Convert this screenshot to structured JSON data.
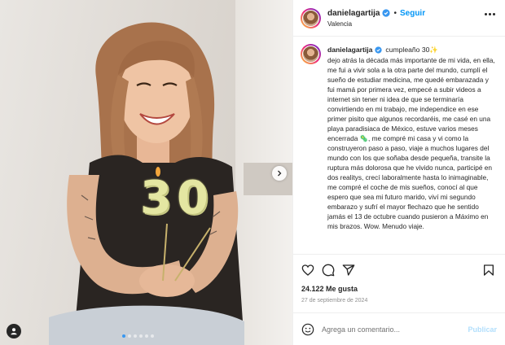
{
  "post": {
    "username": "danielagartija",
    "follow_label": "Seguir",
    "separator": "•",
    "location": "Valencia",
    "caption_title": "cumpleaño 30✨",
    "caption_text": "dejo atrás la década más importante de mi vida, en ella, me fui a vivir sola a la otra parte del mundo, cumplí el sueño de estudiar medicina, me quedé embarazada y fui mamá por primera vez, empecé a subir videos a internet sin tener ni idea de que se terminaría convirtiendo en mi trabajo, me independice en ese primer pisito que algunos recordaréis, me casé en una playa paradisiaca de México, estuve varios meses encerrada 🦠, me compré mi casa y vi como la construyeron paso a paso, viaje a muchos lugares del mundo con los que soñaba desde pequeña, transite la ruptura más dolorosa que he vivido nunca, participé en dos realitys, crecí laboralmente hasta lo inimaginable, me compré el coche de mis sueños, conocí al que espero que sea mi futuro marido, viví mi segundo embarazo y sufrí el mayor flechazo que he sentido jamás el 13 de octubre cuando pusieron a Máximo en mis brazos. Wow. Menudo viaje.",
    "likes": "24.122 Me gusta",
    "date": "27 de septiembre de 2024",
    "comment_placeholder": "Agrega un comentario...",
    "publish_label": "Publicar",
    "candle_number": "30",
    "carousel": {
      "count": 6,
      "active_index": 0
    }
  },
  "colors": {
    "accent": "#0095f6",
    "verified": "#3897f0",
    "publish_disabled": "#b2dffc",
    "candle": "#e4e6a2"
  },
  "icons": {
    "more": "more-options-icon",
    "like": "heart-icon",
    "comment": "comment-icon",
    "share": "share-icon",
    "save": "bookmark-icon",
    "emoji": "emoji-icon",
    "next": "chevron-right-icon",
    "tagged": "user-tag-icon",
    "verified": "verified-badge-icon"
  }
}
